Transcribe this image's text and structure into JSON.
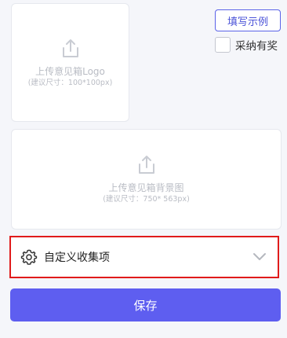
{
  "logo_upload": {
    "title": "上传意见箱Logo",
    "hint": "(建议尺寸：100*100px)",
    "icon": "upload-icon"
  },
  "background_upload": {
    "title": "上传意见箱背景图",
    "hint": "(建议尺寸：750* 563px)",
    "icon": "upload-icon"
  },
  "example_button": {
    "label": "填写示例"
  },
  "reward_option": {
    "label": "采纳有奖",
    "checked": false
  },
  "custom_collect": {
    "label": "自定义收集项",
    "icon": "gear-icon",
    "expand_icon": "chevron-down-icon",
    "expanded": false
  },
  "save_button": {
    "label": "保存"
  },
  "colors": {
    "accent": "#5e5ef0",
    "highlight_border": "#e01b1b",
    "placeholder_text": "#b9bcc4"
  }
}
